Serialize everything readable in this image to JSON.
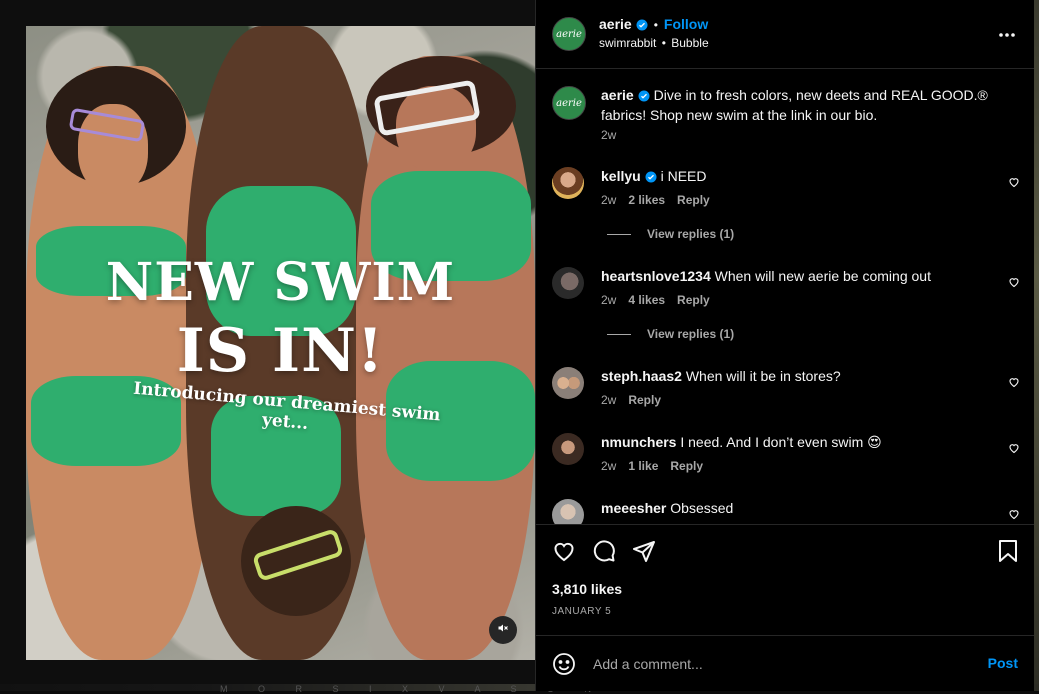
{
  "colors": {
    "accent": "#0095f6",
    "background": "#000000",
    "swimsuit": "#2fae6e"
  },
  "media": {
    "headline_line1": "NEW SWIM",
    "headline_line2": "IS IN!",
    "tagline": "Introducing our dreamiest swim yet...",
    "mute_icon": "speaker-muted-icon",
    "bottom_strip_text": "M O R S I X V A S O N"
  },
  "header": {
    "account": "aerie",
    "verified_icon": "verified-badge-icon",
    "separator": "•",
    "follow_label": "Follow",
    "audio_user": "swimrabbit",
    "audio_sep": "•",
    "audio_track": "Bubble",
    "avatar_text": "aerie",
    "more_icon": "more-options-icon"
  },
  "caption": {
    "username": "aerie",
    "text": "Dive in to fresh colors, new deets and REAL GOOD.® fabrics! Shop new swim at the link in our bio.",
    "age": "2w"
  },
  "comments": [
    {
      "username": "kellyu",
      "verified": true,
      "text": "i NEED",
      "age": "2w",
      "likes": "2 likes",
      "reply": "Reply",
      "view_replies": "View replies (1)"
    },
    {
      "username": "heartsnlove1234",
      "verified": false,
      "text": "When will new aerie be coming out",
      "age": "2w",
      "likes": "4 likes",
      "reply": "Reply",
      "view_replies": "View replies (1)"
    },
    {
      "username": "steph.haas2",
      "verified": false,
      "text": "When will it be in stores?",
      "age": "2w",
      "likes": "",
      "reply": "Reply"
    },
    {
      "username": "nmunchers",
      "verified": false,
      "text": "I need. And I don’t even swim 😍",
      "age": "2w",
      "likes": "1 like",
      "reply": "Reply"
    },
    {
      "username": "meeesher",
      "verified": false,
      "text": "Obsessed"
    }
  ],
  "actions": {
    "like_icon": "heart-icon",
    "comment_icon": "comment-icon",
    "share_icon": "send-icon",
    "save_icon": "bookmark-icon",
    "likes_count": "3,810 likes",
    "date": "JANUARY 5"
  },
  "composer": {
    "emoji_icon": "emoji-icon",
    "placeholder": "Add a comment...",
    "post_label": "Post"
  }
}
